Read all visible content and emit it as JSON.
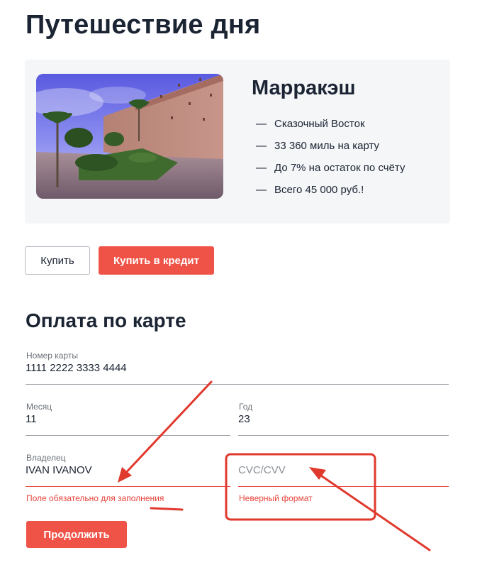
{
  "header": {
    "title": "Путешествие дня"
  },
  "trip": {
    "city": "Марракэш",
    "features": [
      {
        "dash": "—",
        "text": "Сказочный Восток"
      },
      {
        "dash": "—",
        "text": "33 360 миль на карту"
      },
      {
        "dash": "—",
        "text": "До 7% на остаток по счёту"
      },
      {
        "dash": "—",
        "text": "Всего 45 000 руб.!"
      }
    ]
  },
  "buttons": {
    "buy": "Купить",
    "buy_credit": "Купить в кредит",
    "continue": "Продолжить"
  },
  "payment": {
    "title": "Оплата по карте",
    "card_number": {
      "label": "Номер карты",
      "value": "1111 2222 3333 4444"
    },
    "month": {
      "label": "Месяц",
      "value": "11"
    },
    "year": {
      "label": "Год",
      "value": "23"
    },
    "owner": {
      "label": "Владелец",
      "value": "IVAN IVANOV",
      "error": "Поле обязательно для заполнения"
    },
    "cvc": {
      "placeholder": "CVC/CVV",
      "value": "",
      "error": "Неверный формат"
    }
  },
  "colors": {
    "accent": "#ef5246",
    "error": "#e8453c",
    "annotation": "#e0392d",
    "card_bg": "#f4f6f8",
    "text": "#1b2433"
  },
  "icons": {
    "photo": "marrakech-wall-photo"
  }
}
